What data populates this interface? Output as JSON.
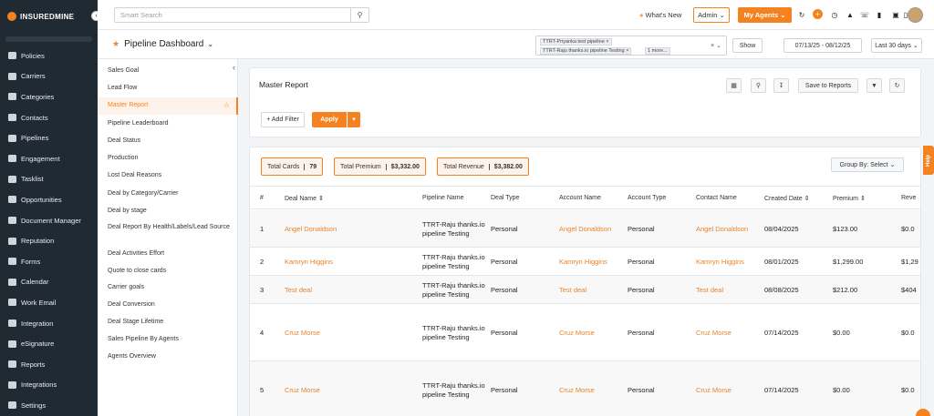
{
  "nav": {
    "logo": "INSUREDMINE",
    "collapse": "‹",
    "items": [
      "Policies",
      "Carriers",
      "Categories",
      "Contacts",
      "Pipelines",
      "Engagement",
      "Tasklist",
      "Opportunities",
      "Document Manager",
      "Reputation",
      "Forms",
      "Calendar",
      "Work Email",
      "Integration",
      "eSignature",
      "Reports",
      "Integrations",
      "Settings"
    ]
  },
  "topbar": {
    "search_placeholder": "Smart Search",
    "search_icon": "search-icon",
    "whats_new": "What's New",
    "admin": "Admin",
    "admin_caret": "⌄",
    "my_agents": "My Agents",
    "my_agents_caret": "⌄"
  },
  "dashboard": {
    "title": "Pipeline Dashboard",
    "pipeline_tags": [
      "TTRT-Priyanka test pipeline",
      "TTRT-Raju thanks.io pipeline Testing",
      "1 more..."
    ],
    "show": "Show",
    "date_range": "07/13/25 - 08/12/25",
    "period": "Last 30 days"
  },
  "reports_sidebar": {
    "items": [
      "Sales Goal",
      "Lead Flow",
      "Master Report",
      "Pipeline Leaderboard",
      "Deal Status",
      "Production",
      "Lost Deal Reasons",
      "Deal by Category/Carrier",
      "Deal by stage",
      "Deal Report By Health/Labels/Lead Source",
      "Deal Activities Effort",
      "Quote to close cards",
      "Carrier goals",
      "Deal Conversion",
      "Deal Stage Lifetime",
      "Sales Pipeline By Agents",
      "Agents Overview"
    ],
    "active_index": 2
  },
  "master_report": {
    "title": "Master Report",
    "save_to_reports": "Save to Reports",
    "add_filter": "+ Add Filter",
    "apply": "Apply"
  },
  "summary": {
    "total_cards_label": "Total Cards",
    "total_cards": "79",
    "total_premium_label": "Total Premium",
    "total_premium": "$3,332.00",
    "total_revenue_label": "Total Revenue",
    "total_revenue": "$3,382.00",
    "group_by": "Group By: Select"
  },
  "table": {
    "columns": [
      "#",
      "Deal Name ⇕",
      "Pipeline Name",
      "Deal Type",
      "Account Name",
      "Account Type",
      "Contact Name",
      "Created Date ⇕",
      "Premium ⇕",
      "Reve"
    ],
    "rows": [
      {
        "num": "1",
        "deal": "Angel Donaldson",
        "pipeline": "TTRT-Raju thanks.io pipeline Testing",
        "type": "Personal",
        "account": "Angel Donaldson",
        "acct_type": "Personal",
        "contact": "Angel Donaldson",
        "created": "08/04/2025",
        "premium": "$123.00",
        "revenue": "$0.0"
      },
      {
        "num": "2",
        "deal": "Kamryn Higgins",
        "pipeline": "TTRT-Raju thanks.io pipeline Testing",
        "type": "Personal",
        "account": "Kamryn Higgins",
        "acct_type": "Personal",
        "contact": "Kamryn Higgins",
        "created": "08/01/2025",
        "premium": "$1,299.00",
        "revenue": "$1,29"
      },
      {
        "num": "3",
        "deal": "Test deal",
        "pipeline": "TTRT-Raju thanks.io pipeline Testing",
        "type": "Personal",
        "account": "Test deal",
        "acct_type": "Personal",
        "contact": "Test deal",
        "created": "08/08/2025",
        "premium": "$212.00",
        "revenue": "$404"
      },
      {
        "num": "4",
        "deal": "Cruz Morse",
        "pipeline": "TTRT-Raju thanks.io pipeline Testing",
        "type": "Personal",
        "account": "Cruz Morse",
        "acct_type": "Personal",
        "contact": "Cruz Morse",
        "created": "07/14/2025",
        "premium": "$0.00",
        "revenue": "$0.0"
      },
      {
        "num": "5",
        "deal": "Cruz Morse",
        "pipeline": "TTRT-Raju thanks.io pipeline Testing",
        "type": "Personal",
        "account": "Cruz Morse",
        "acct_type": "Personal",
        "contact": "Cruz Morse",
        "created": "07/14/2025",
        "premium": "$0.00",
        "revenue": "$0.0"
      }
    ]
  },
  "help_tab": "Help",
  "colors": {
    "accent": "#f58220",
    "nav_bg": "#1f2a33",
    "link": "#e8832a"
  }
}
